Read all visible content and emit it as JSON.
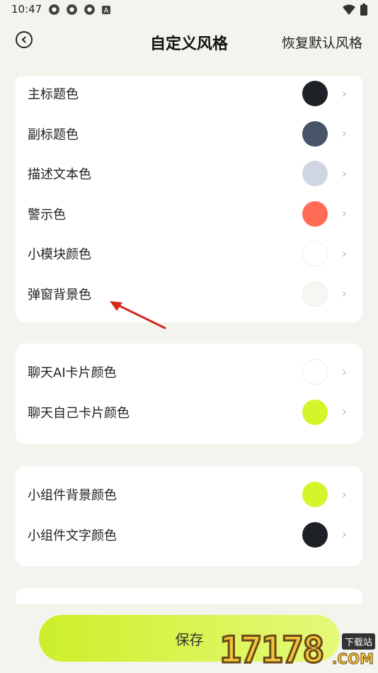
{
  "status_bar": {
    "time": "10:47",
    "icons": [
      "settings-icon",
      "settings-icon",
      "settings-icon",
      "a-icon"
    ],
    "right_icons": [
      "wifi-icon",
      "battery-icon"
    ]
  },
  "header": {
    "title": "自定义风格",
    "restore_label": "恢复默认风格"
  },
  "groups": [
    {
      "rows": [
        {
          "label": "主标题色",
          "color": "#1e2126"
        },
        {
          "label": "副标题色",
          "color": "#475366"
        },
        {
          "label": "描述文本色",
          "color": "#cdd6e1"
        },
        {
          "label": "警示色",
          "color": "#ff6b55"
        },
        {
          "label": "小模块颜色",
          "color": "#ffffff"
        },
        {
          "label": "弹窗背景色",
          "color": "#f6f6f3"
        }
      ]
    },
    {
      "rows": [
        {
          "label": "聊天AI卡片颜色",
          "color": "#ffffff"
        },
        {
          "label": "聊天自己卡片颜色",
          "color": "#d6f42a"
        }
      ]
    },
    {
      "rows": [
        {
          "label": "小组件背景颜色",
          "color": "#d6f42a"
        },
        {
          "label": "小组件文字颜色",
          "color": "#1e2126"
        }
      ]
    }
  ],
  "save_label": "保存",
  "watermark": {
    "number": "17178",
    "tag": "下载站",
    "suffix": ".COM"
  }
}
